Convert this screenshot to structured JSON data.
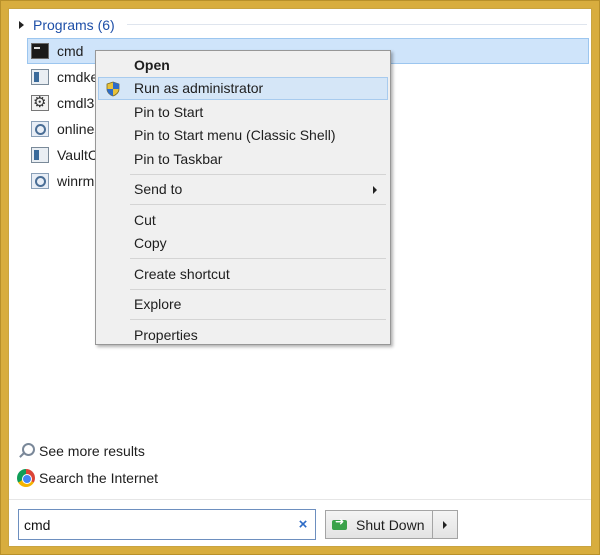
{
  "programs": {
    "header": "Programs (6)",
    "items": [
      {
        "label": "cmd",
        "icon": "cmd-icon"
      },
      {
        "label": "cmdkey",
        "icon": "window-icon"
      },
      {
        "label": "cmdl32",
        "icon": "gear-icon"
      },
      {
        "label": "onlinesetup",
        "icon": "magnifier-icon"
      },
      {
        "label": "VaultCmd",
        "icon": "window-icon"
      },
      {
        "label": "winrm",
        "icon": "magnifier-icon"
      }
    ]
  },
  "context_menu": {
    "open": "Open",
    "run_as_admin": "Run as administrator",
    "pin_start": "Pin to Start",
    "pin_start_classic": "Pin to Start menu (Classic Shell)",
    "pin_taskbar": "Pin to Taskbar",
    "send_to": "Send to",
    "cut": "Cut",
    "copy": "Copy",
    "create_shortcut": "Create shortcut",
    "explore": "Explore",
    "properties": "Properties"
  },
  "links": {
    "see_more": "See more results",
    "search_internet": "Search the Internet"
  },
  "search": {
    "value": "cmd",
    "clear_glyph": "×"
  },
  "shutdown": {
    "label": "Shut Down"
  },
  "colors": {
    "frame": "#d8ad3e",
    "selection": "#cfe4fa",
    "header_text": "#1e4fa8"
  }
}
